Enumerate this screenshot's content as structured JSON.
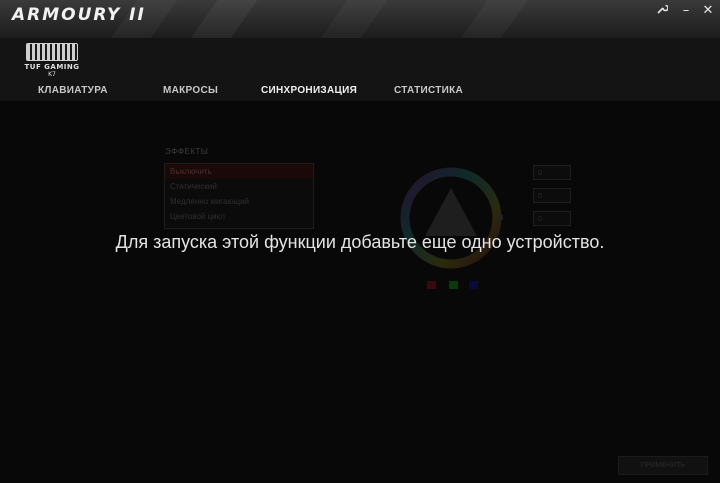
{
  "app": {
    "brand": "ARMOURY II",
    "wrench_icon": "wrench-icon",
    "minimize_glyph": "–",
    "close_glyph": "✕"
  },
  "device": {
    "brand": "TUF GAMING",
    "model": "K7"
  },
  "tabs": [
    {
      "label": "КЛАВИАТУРА",
      "active": false
    },
    {
      "label": "МАКРОСЫ",
      "active": false
    },
    {
      "label": "СИНХРОНИЗАЦИЯ",
      "active": true
    },
    {
      "label": "СТАТИСТИКА",
      "active": false
    }
  ],
  "sync": {
    "effects_title": "ЭФФЕКТЫ",
    "effects": [
      {
        "label": "Выключить",
        "selected": true
      },
      {
        "label": "Статический",
        "selected": false
      },
      {
        "label": "Медленно мигающий",
        "selected": false
      },
      {
        "label": "Цветовой цикл",
        "selected": false
      }
    ],
    "rgb_fields": [
      "0",
      "0",
      "0"
    ],
    "swatch_colors": [
      "#3a0a0a",
      "#0a3a0a",
      "#0a0a3a"
    ],
    "message": "Для запуска этой функции добавьте еще одно устройство.",
    "apply_label": "ПРИМЕНИТЬ"
  }
}
